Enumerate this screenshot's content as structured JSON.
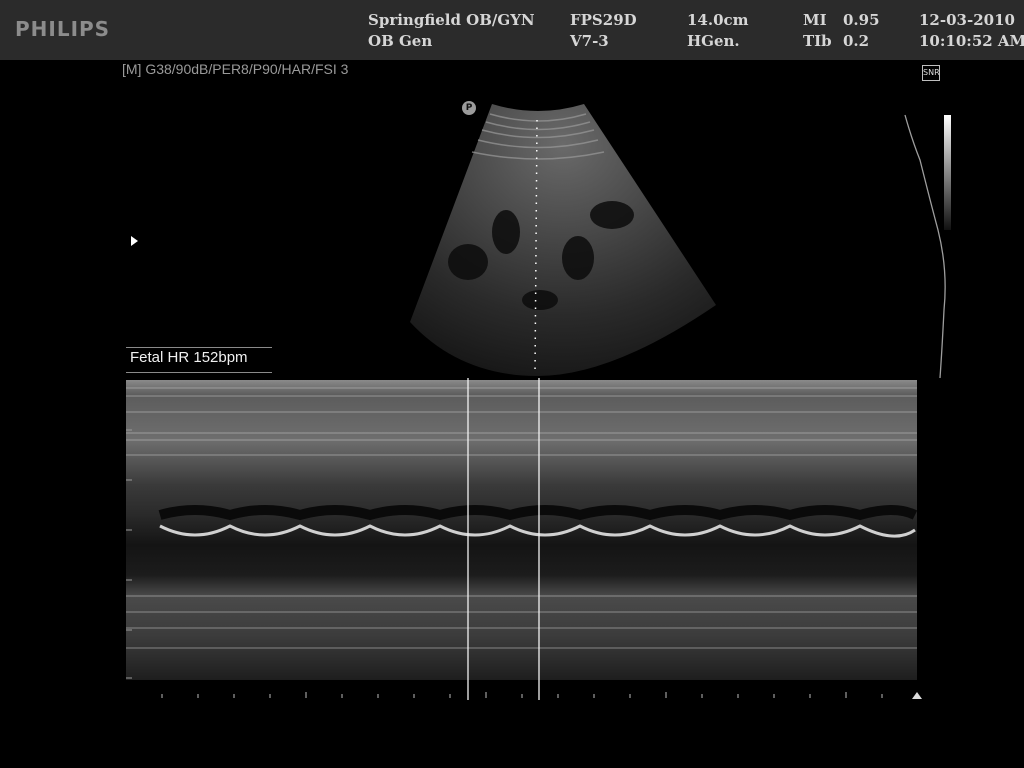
{
  "header": {
    "brand": "PHILIPS",
    "site_line1": "Springfield OB/GYN",
    "site_line2": "OB Gen",
    "transducer_line1": "FPS29D",
    "transducer_line2": "V7-3",
    "depth_line1": "14.0cm",
    "depth_line2": "HGen.",
    "mi_label": "MI",
    "mi_value": "0.95",
    "tib_label": "TIb",
    "tib_value": "0.2",
    "date": "12-03-2010",
    "time": "10:10:52 AM"
  },
  "image_params": "[M] G38/90dB/PER8/P90/HAR/FSI 3",
  "snr_icon_text": "SNR",
  "probe_badge": "P",
  "measurement": {
    "label": "Fetal HR 152bpm"
  },
  "colors": {
    "topbar": "#2b2b2b",
    "header_text": "#d6d6d6",
    "brand_text": "#8c8c8c",
    "background": "#000000"
  }
}
